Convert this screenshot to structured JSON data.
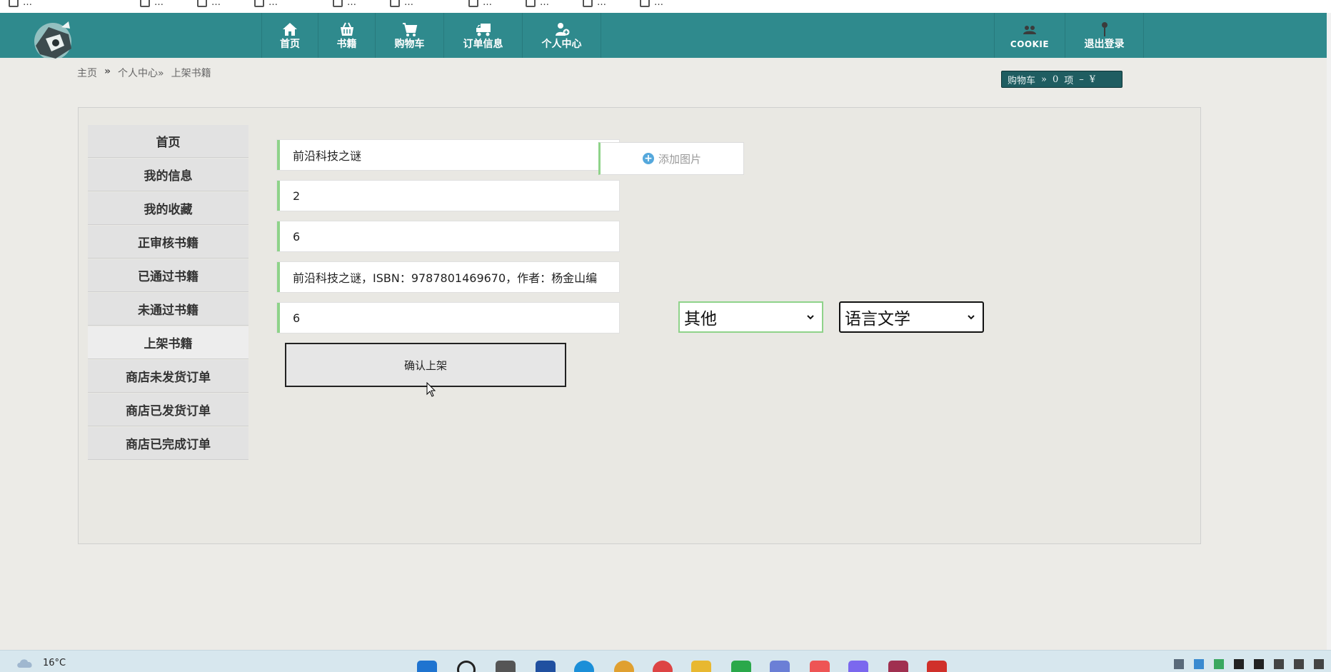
{
  "bookmarks": [
    {
      "label": "…",
      "icon": "bookmark-icon"
    },
    {
      "label": "…",
      "icon": "bookmark-icon"
    },
    {
      "label": "…",
      "icon": "bookmark-icon"
    },
    {
      "label": "…",
      "icon": "bookmark-icon"
    },
    {
      "label": "…",
      "icon": "bookmark-icon"
    },
    {
      "label": "…",
      "icon": "bookmark-icon"
    },
    {
      "label": "…",
      "icon": "bookmark-icon"
    },
    {
      "label": "…",
      "icon": "bookmark-icon"
    },
    {
      "label": "…",
      "icon": "bookmark-icon"
    },
    {
      "label": "…",
      "icon": "bookmark-icon"
    }
  ],
  "nav": {
    "items": [
      {
        "label": "首页",
        "icon": "home-icon"
      },
      {
        "label": "书籍",
        "icon": "basket-icon"
      },
      {
        "label": "购物车",
        "icon": "cart-icon"
      },
      {
        "label": "订单信息",
        "icon": "truck-icon"
      },
      {
        "label": "个人中心",
        "icon": "user-add-icon"
      }
    ],
    "right": [
      {
        "label": "COOKIE",
        "icon": "cookie-icon"
      },
      {
        "label": "退出登录",
        "icon": "pin-icon"
      }
    ],
    "accent": "#2f8a8d"
  },
  "breadcrumb": {
    "home": "主页",
    "sep": "»",
    "parent": "个人中心»",
    "current": "上架书籍"
  },
  "cart_summary": {
    "label": "购物车",
    "arrow": "»",
    "count": "0",
    "unit": "项",
    "dash": "–",
    "currency": "¥"
  },
  "sidebar": {
    "items": [
      {
        "label": "首页"
      },
      {
        "label": "我的信息"
      },
      {
        "label": "我的收藏"
      },
      {
        "label": "正审核书籍"
      },
      {
        "label": "已通过书籍"
      },
      {
        "label": "未通过书籍"
      },
      {
        "label": "上架书籍",
        "active": true
      },
      {
        "label": "商店未发货订单"
      },
      {
        "label": "商店已发货订单"
      },
      {
        "label": "商店已完成订单"
      }
    ]
  },
  "form": {
    "book_name": "前沿科技之谜",
    "field2": "2",
    "field3": "6",
    "description": "前沿科技之谜，ISBN：9787801469670，作者：杨金山编",
    "field5": "6",
    "add_image_label": "添加图片",
    "select1_value": "其他",
    "select2_value": "语言文学",
    "submit_label": "确认上架",
    "field_accent": "#8fd38a"
  },
  "taskbar": {
    "temperature": "16°C"
  }
}
